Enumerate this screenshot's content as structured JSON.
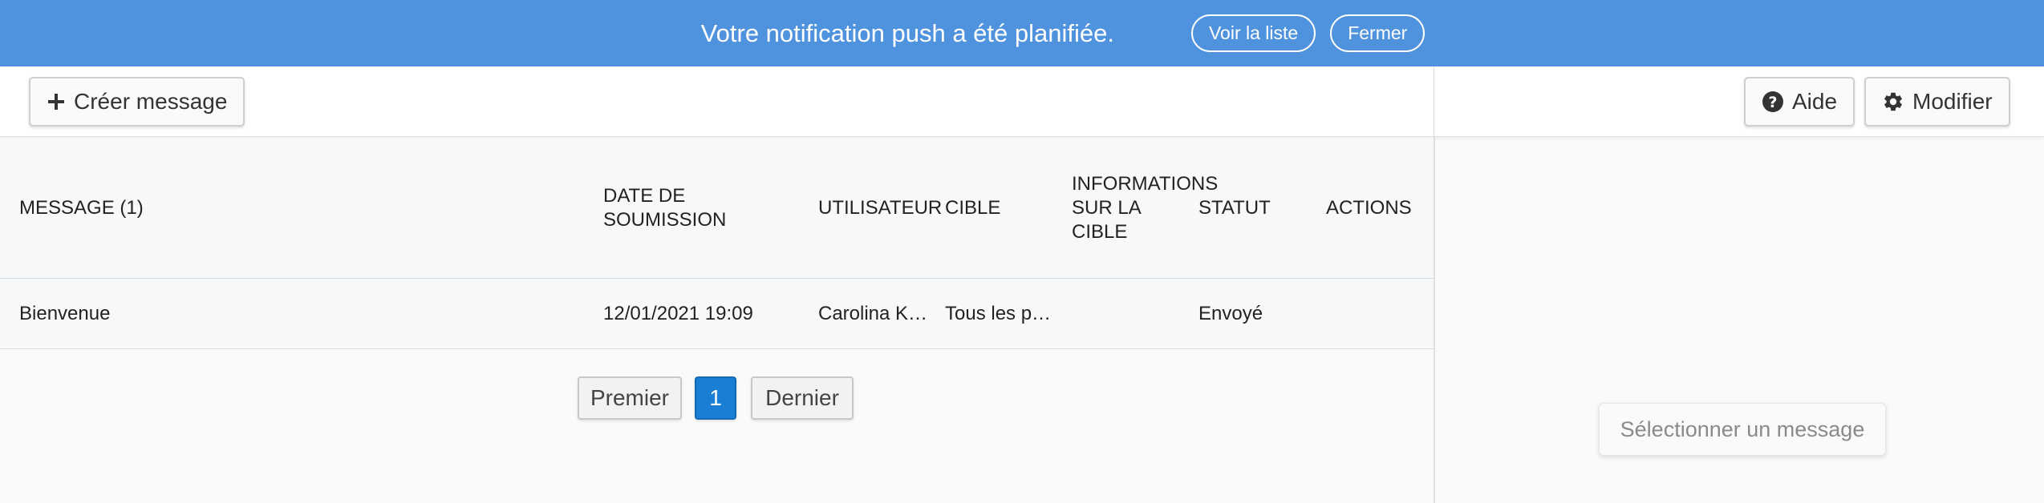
{
  "banner": {
    "message": "Votre notification push a été planifiée.",
    "view_list_label": "Voir la liste",
    "close_label": "Fermer",
    "color": "#4f93df"
  },
  "toolbar": {
    "create_label": "Créer message",
    "create_icon": "plus-icon",
    "help_label": "Aide",
    "help_icon": "question-circle-icon",
    "settings_label": "Modifier",
    "settings_icon": "gear-icon"
  },
  "table": {
    "columns": [
      "MESSAGE (1)",
      "DATE DE SOUMISSION",
      "UTILISATEUR",
      "CIBLE",
      "INFORMATIONS SUR LA CIBLE",
      "STATUT",
      "ACTIONS"
    ],
    "header_lines": {
      "date": [
        "DATE DE",
        "SOUMISSION"
      ],
      "info": [
        "INFORMATIONS",
        "SUR LA",
        "CIBLE"
      ]
    },
    "rows": [
      {
        "message": "Bienvenue",
        "date": "12/01/2021 19:09",
        "user": "Carolina K…",
        "target": "Tous les p…",
        "target_info": "",
        "status": "Envoyé",
        "actions": ""
      }
    ]
  },
  "pagination": {
    "first_label": "Premier",
    "current_page": "1",
    "last_label": "Dernier",
    "active_color": "#1a7fd4"
  },
  "detail_panel": {
    "empty_label": "Sélectionner un message"
  }
}
